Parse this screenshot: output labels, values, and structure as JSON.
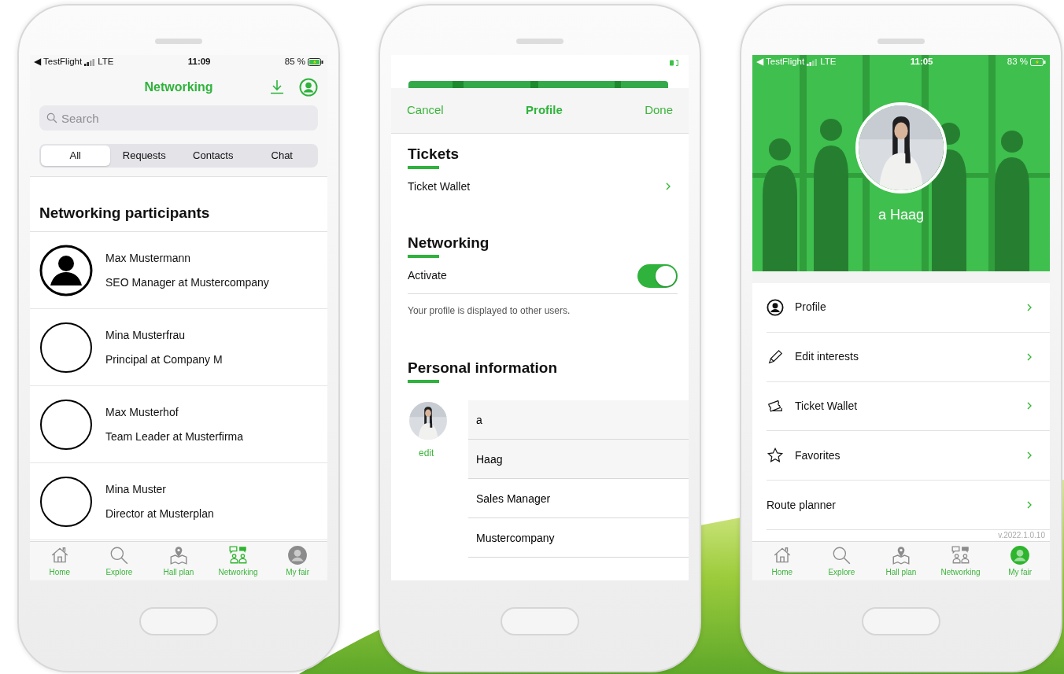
{
  "networking_screen": {
    "status_bar": {
      "carrier": "◀ TestFlight",
      "network": "LTE",
      "time": "11:09",
      "battery": "85 %"
    },
    "title": "Networking",
    "search": {
      "placeholder": "Search"
    },
    "segments": [
      {
        "label": "All",
        "selected": true
      },
      {
        "label": "Requests",
        "selected": false
      },
      {
        "label": "Contacts",
        "selected": false
      },
      {
        "label": "Chat",
        "selected": false
      }
    ],
    "section_title": "Networking participants",
    "participants": [
      {
        "name": "Max Mustermann",
        "subtitle": "SEO Manager  at  Mustercompany",
        "kind": "silhouette"
      },
      {
        "name": "Mina Musterfrau",
        "subtitle": "Principal  at  Company M",
        "kind": "blank"
      },
      {
        "name": "Max Musterhof",
        "subtitle": "Team Leader  at  Musterfirma",
        "kind": "blank"
      },
      {
        "name": "Mina Muster",
        "subtitle": "Director  at  Musterplan",
        "kind": "blank"
      }
    ],
    "tab_bar": [
      {
        "label": "Home",
        "selected": false
      },
      {
        "label": "Explore",
        "selected": false
      },
      {
        "label": "Hall plan",
        "selected": false
      },
      {
        "label": "Networking",
        "selected": true
      },
      {
        "label": "My fair",
        "selected": false
      }
    ]
  },
  "profile_edit_screen": {
    "nav": {
      "cancel": "Cancel",
      "title": "Profile",
      "done": "Done"
    },
    "sections": [
      {
        "title": "Tickets",
        "rows": [
          {
            "kind": "link",
            "label": "Ticket Wallet"
          }
        ]
      },
      {
        "title": "Networking",
        "rows": [
          {
            "kind": "toggle",
            "label": "Activate",
            "on": true
          }
        ],
        "note": "Your profile is displayed to other users."
      }
    ],
    "personal_information": {
      "title": "Personal information",
      "edit_link": "edit",
      "fields": [
        {
          "value": "a"
        },
        {
          "value": "Haag"
        },
        {
          "value": "Sales Manager"
        },
        {
          "value": "Mustercompany"
        }
      ]
    }
  },
  "my_fair_screen": {
    "status_bar": {
      "carrier": "◀ TestFlight",
      "network": "LTE",
      "time": "11:05",
      "battery": "83 %"
    },
    "user_name": "a Haag",
    "menu": [
      {
        "label": "Profile"
      },
      {
        "label": "Edit interests"
      },
      {
        "label": "Ticket Wallet"
      },
      {
        "label": "Favorites"
      },
      {
        "label": "Route planner"
      }
    ],
    "version": "v.2022.1.0.10",
    "tab_bar": [
      {
        "label": "Home",
        "selected": false
      },
      {
        "label": "Explore",
        "selected": false
      },
      {
        "label": "Hall plan",
        "selected": false
      },
      {
        "label": "Networking",
        "selected": false
      },
      {
        "label": "My fair",
        "selected": true
      }
    ]
  }
}
